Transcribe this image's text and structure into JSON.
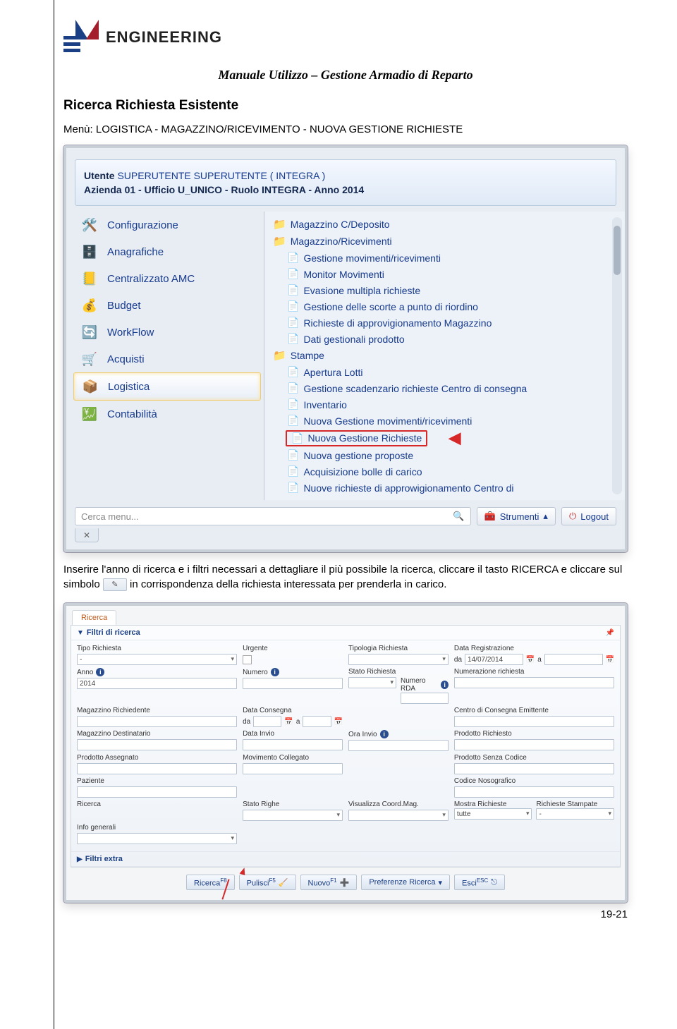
{
  "header": {
    "brand": "ENGINEERING",
    "doc_title": "Manuale Utilizzo – Gestione Armadio di Reparto"
  },
  "section_heading": "Ricerca Richiesta Esistente",
  "menu_line": "Menù: LOGISTICA - MAGAZZINO/RICEVIMENTO - NUOVA GESTIONE RICHIESTE",
  "body_text_1": "Inserire l'anno di ricerca e i filtri necessari a dettagliare il più possibile la ricerca, cliccare il tasto RICERCA e cliccare sul simbolo",
  "body_text_2": "in corrispondenza della richiesta interessata per prenderla in carico.",
  "pencil_glyph": "✎",
  "shot1": {
    "context": {
      "utente_label": "Utente",
      "utente_value": "SUPERUTENTE SUPERUTENTE ( INTEGRA )",
      "azienda_line": "Azienda 01 - Ufficio U_UNICO - Ruolo INTEGRA - Anno 2014"
    },
    "left_nav": [
      {
        "icon": "🛠️",
        "label": "Configurazione"
      },
      {
        "icon": "🗄️",
        "label": "Anagrafiche"
      },
      {
        "icon": "📒",
        "label": "Centralizzato AMC"
      },
      {
        "icon": "💰",
        "label": "Budget"
      },
      {
        "icon": "🔄",
        "label": "WorkFlow"
      },
      {
        "icon": "🛒",
        "label": "Acquisti"
      },
      {
        "icon": "📦",
        "label": "Logistica",
        "selected": true
      },
      {
        "icon": "💹",
        "label": "Contabilità"
      }
    ],
    "right_tree": {
      "folders": [
        "Magazzino C/Deposito",
        "Magazzino/Ricevimenti"
      ],
      "items_before": [
        "Gestione movimenti/ricevimenti",
        "Monitor Movimenti",
        "Evasione multipla richieste",
        "Gestione delle scorte a punto di riordino",
        "Richieste di approvigionamento Magazzino",
        "Dati gestionali prodotto"
      ],
      "folder_mid": "Stampe",
      "items_mid": [
        "Apertura Lotti",
        "Gestione scadenzario richieste Centro di consegna",
        "Inventario",
        "Nuova Gestione movimenti/ricevimenti"
      ],
      "highlight": "Nuova Gestione Richieste",
      "items_after": [
        "Nuova gestione proposte",
        "Acquisizione bolle di carico",
        "Nuove richieste di approwigionamento Centro di"
      ]
    },
    "search_placeholder": "Cerca menu...",
    "tools_btn": "Strumenti",
    "logout_btn": "Logout",
    "close_x": "✕"
  },
  "shot2": {
    "tab": "Ricerca",
    "filters_head": "Filtri di ricerca",
    "extra_head": "Filtri extra",
    "pin": "📌",
    "rows": [
      [
        {
          "label": "Tipo Richiesta",
          "type": "dd",
          "value": "-"
        },
        {
          "label": "Urgente",
          "type": "chk"
        },
        {
          "label": "Tipologia Richiesta",
          "type": "dd"
        },
        {
          "label": "Data Registrazione",
          "type": "datepair",
          "from": "14/07/2014"
        }
      ],
      [
        {
          "label": "Anno",
          "type": "txt",
          "value": "2014",
          "info": true
        },
        {
          "label": "Numero",
          "type": "txt",
          "info": true
        },
        {
          "label": "Stato Richiesta",
          "type": "dd",
          "sub": "Numero RDA",
          "subinfo": true
        },
        {
          "label": "Numerazione richiesta",
          "type": "txt"
        }
      ],
      [
        {
          "label": "Magazzino Richiedente",
          "type": "txt"
        },
        {
          "label": "Data Consegna",
          "type": "datepair"
        },
        {
          "label": "",
          "type": "spacer"
        },
        {
          "label": "Centro di Consegna Emittente",
          "type": "txt"
        }
      ],
      [
        {
          "label": "Magazzino Destinatario",
          "type": "txt"
        },
        {
          "label": "Data Invio",
          "type": "txt"
        },
        {
          "label": "Ora Invio",
          "type": "txt",
          "info": true
        },
        {
          "label": "Prodotto Richiesto",
          "type": "txt"
        }
      ],
      [
        {
          "label": "Prodotto Assegnato",
          "type": "txt"
        },
        {
          "label": "Movimento Collegato",
          "type": "txt"
        },
        {
          "label": "",
          "type": "spacer"
        },
        {
          "label": "Prodotto Senza Codice",
          "type": "txt"
        }
      ],
      [
        {
          "label": "Paziente",
          "type": "txt"
        },
        {
          "label": "",
          "type": "spacer"
        },
        {
          "label": "",
          "type": "spacer"
        },
        {
          "label": "Codice Nosografico",
          "type": "txt"
        }
      ],
      [
        {
          "label": "Ricerca",
          "type": "label_only"
        },
        {
          "label": "Stato Righe",
          "type": "dd"
        },
        {
          "label": "Visualizza Coord.Mag.",
          "type": "dd"
        },
        {
          "label": "Mostra Richieste",
          "type": "dd",
          "value": "tutte",
          "sub2": "Richieste Stampate",
          "sub2val": "-"
        }
      ],
      [
        {
          "label": "Info generali",
          "type": "dd"
        },
        {
          "label": "",
          "type": "spacer"
        },
        {
          "label": "",
          "type": "spacer"
        },
        {
          "label": "",
          "type": "spacer"
        }
      ]
    ],
    "buttons": [
      {
        "label": "Ricerca",
        "sup": "F8"
      },
      {
        "label": "Pulisci",
        "sup": "F5",
        "icon": "🧹"
      },
      {
        "label": "Nuovo",
        "sup": "F1",
        "icon": "➕"
      },
      {
        "label": "Preferenze Ricerca",
        "dd": true
      },
      {
        "label": "Esci",
        "sup": "ESC",
        "icon": "⎋"
      }
    ]
  },
  "pagenum": "19-21"
}
